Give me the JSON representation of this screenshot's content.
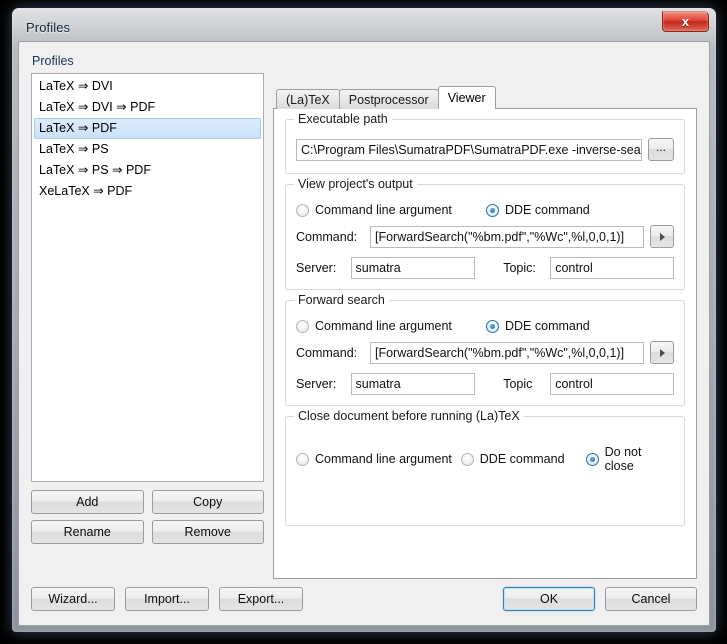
{
  "window": {
    "title": "Profiles",
    "close_label": "x"
  },
  "left": {
    "group_label": "Profiles",
    "profiles": [
      "LaTeX ⇒ DVI",
      "LaTeX ⇒ DVI ⇒ PDF",
      "LaTeX ⇒ PDF",
      "LaTeX ⇒ PS",
      "LaTeX ⇒ PS ⇒ PDF",
      "XeLaTeX ⇒ PDF"
    ],
    "selected_index": 2,
    "buttons": {
      "add": "Add",
      "copy": "Copy",
      "rename": "Rename",
      "remove": "Remove"
    }
  },
  "tabs": [
    {
      "label": "(La)TeX",
      "active": false
    },
    {
      "label": "Postprocessor",
      "active": false
    },
    {
      "label": "Viewer",
      "active": true
    }
  ],
  "viewer": {
    "executable": {
      "title": "Executable path",
      "value": "C:\\Program Files\\SumatraPDF\\SumatraPDF.exe -inverse-search \"\\\"C:\\Program Files\\TeXstudio\\texstudio.exe\\\" \"%f\" -line %l\"",
      "browse_label": "..."
    },
    "view_output": {
      "title": "View project's output",
      "radio_cmdline": "Command line argument",
      "radio_dde": "DDE command",
      "selected": "dde",
      "command_label": "Command:",
      "command_value": "[ForwardSearch(\"%bm.pdf\",\"%Wc\",%l,0,0,1)]",
      "server_label": "Server:",
      "server_value": "sumatra",
      "topic_label": "Topic:",
      "topic_value": "control",
      "run_icon": "play-triangle-icon"
    },
    "forward_search": {
      "title": "Forward search",
      "radio_cmdline": "Command line argument",
      "radio_dde": "DDE command",
      "selected": "dde",
      "command_label": "Command:",
      "command_value": "[ForwardSearch(\"%bm.pdf\",\"%Wc\",%l,0,0,1)]",
      "server_label": "Server:",
      "server_value": "sumatra",
      "topic_label": "Topic",
      "topic_value": "control",
      "run_icon": "play-triangle-icon"
    },
    "close_document": {
      "title": "Close document before running (La)TeX",
      "radio_cmdline": "Command line argument",
      "radio_dde": "DDE command",
      "radio_donotclose": "Do not close",
      "selected": "donotclose"
    }
  },
  "footer": {
    "wizard": "Wizard...",
    "import": "Import...",
    "export": "Export...",
    "ok": "OK",
    "cancel": "Cancel"
  }
}
